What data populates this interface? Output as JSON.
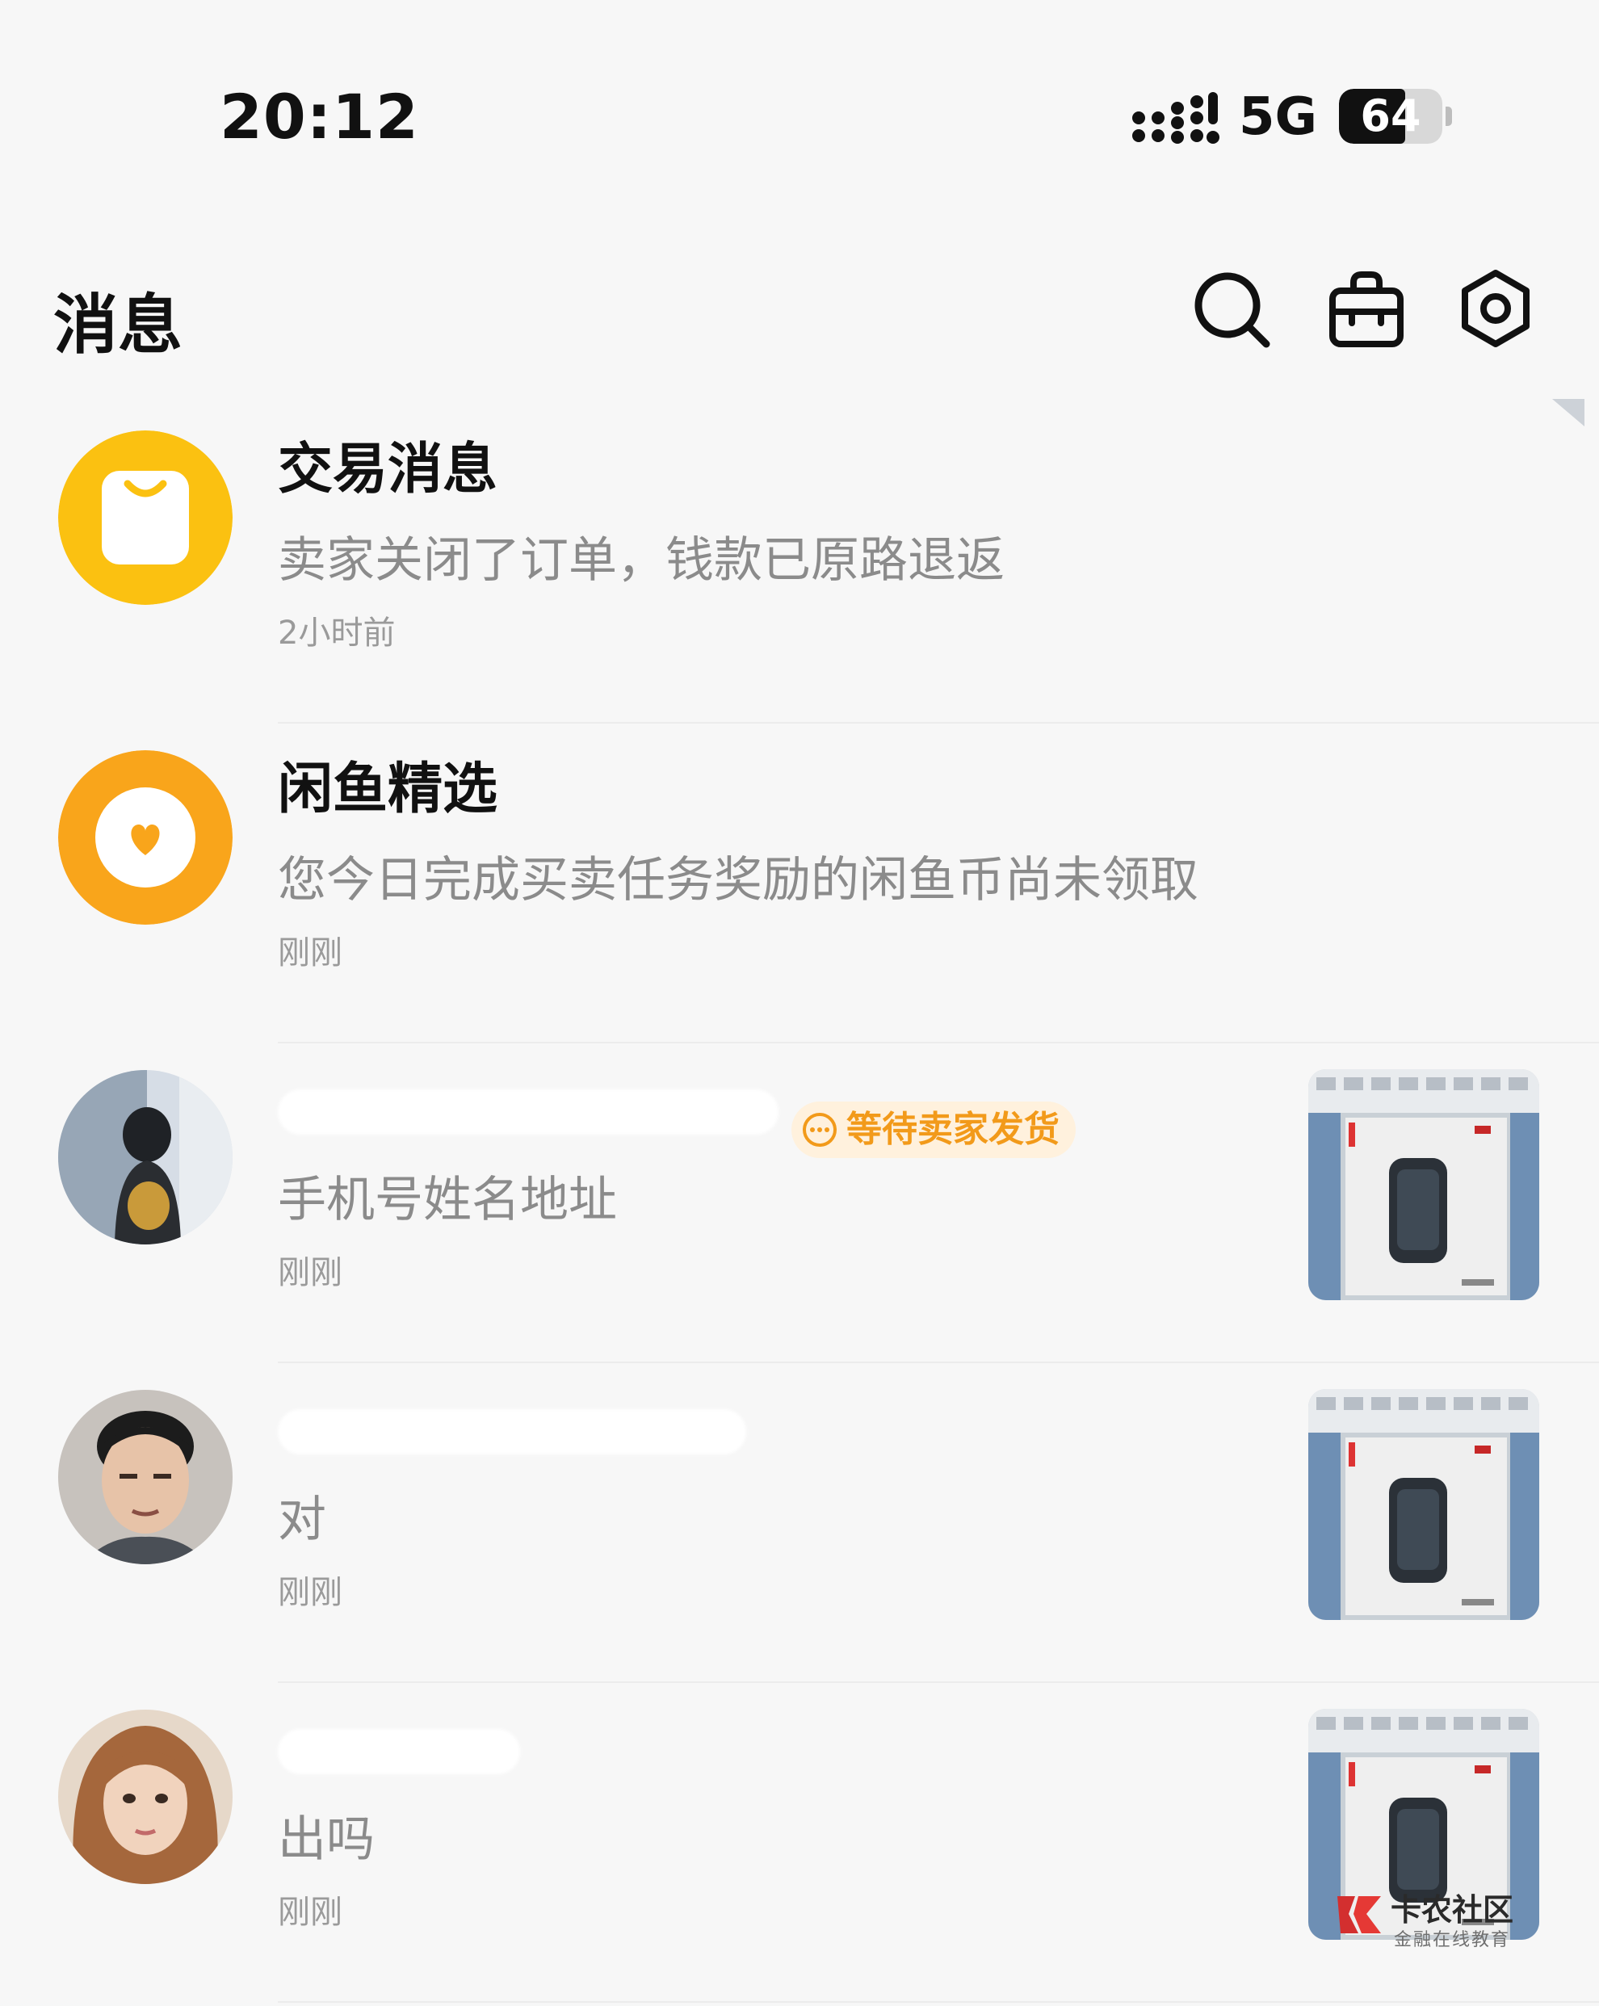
{
  "status_bar": {
    "time": "20:12",
    "network": "5G",
    "battery": "64",
    "battery_level": 0.64
  },
  "header": {
    "title": "消息",
    "search_icon": "search-icon",
    "shop_icon": "shopping-bag-icon",
    "settings_icon": "settings-icon"
  },
  "conversations": [
    {
      "name": "交易消息",
      "preview": "卖家关闭了订单，钱款已原路退返",
      "time": "2小时前",
      "avatar": "yellow-bag-icon",
      "avatar_color": "#fbc111"
    },
    {
      "name": "闲鱼精选",
      "preview": "您今日完成买卖任务奖励的闲鱼币尚未领取",
      "time": "刚刚",
      "avatar": "orange-heart-icon",
      "avatar_color": "#f9a51b"
    },
    {
      "name": "",
      "badge": "等待卖家发货",
      "preview": "手机号姓名地址",
      "time": "刚刚",
      "avatar": "user-photo",
      "thumbnail": "smartwatch-box-photo"
    },
    {
      "name": "",
      "preview": "对",
      "time": "刚刚",
      "avatar": "user-photo",
      "thumbnail": "smartwatch-box-photo"
    },
    {
      "name": "",
      "preview": "出吗",
      "time": "刚刚",
      "avatar": "user-photo",
      "thumbnail": "smartwatch-box-photo"
    }
  ],
  "watermark": {
    "title": "卡农社区",
    "subtitle": "金融在线教育"
  },
  "colors": {
    "accent_orange": "#f29a1a",
    "badge_background": "#fff1dd",
    "background": "#f7f7f7"
  }
}
